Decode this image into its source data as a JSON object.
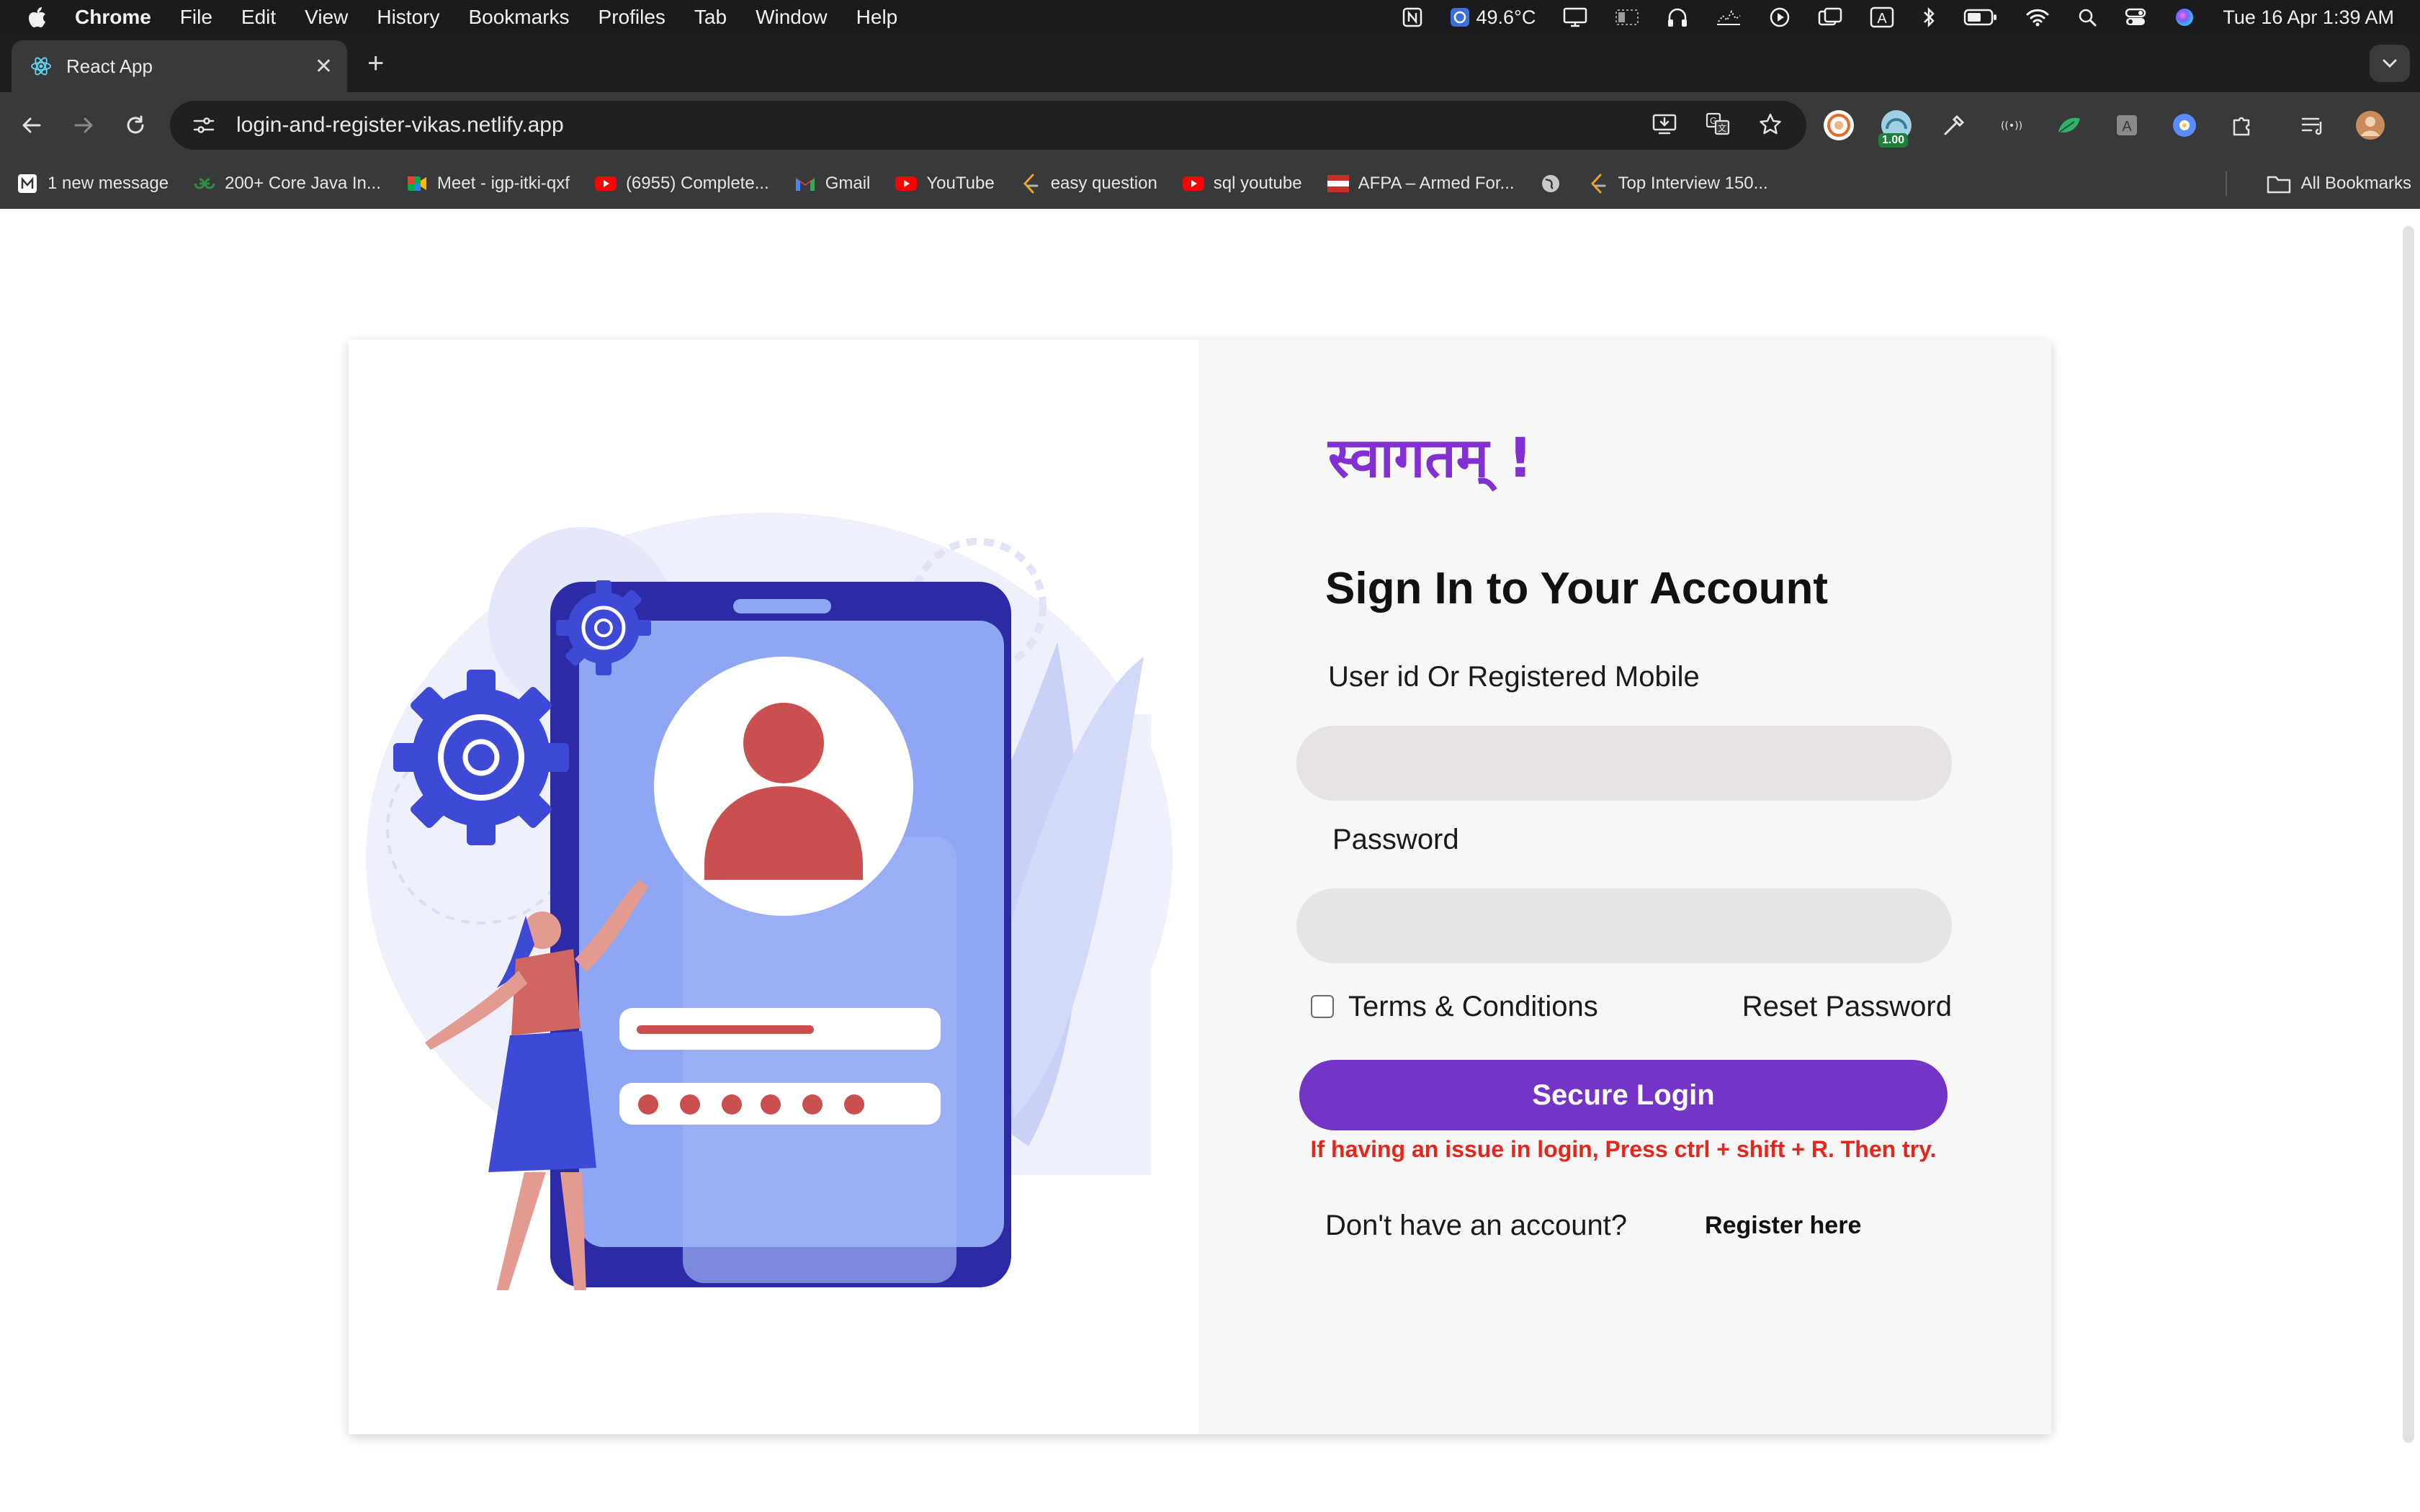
{
  "menubar": {
    "app_name": "Chrome",
    "items": [
      "File",
      "Edit",
      "View",
      "History",
      "Bookmarks",
      "Profiles",
      "Tab",
      "Window",
      "Help"
    ],
    "temperature": "49.6°C",
    "datetime": "Tue 16 Apr  1:39 AM"
  },
  "browser": {
    "tab_title": "React App",
    "url": "login-and-register-vikas.netlify.app",
    "extension_badge": "1.00",
    "bookmarks": [
      "1 new message",
      "200+ Core Java In...",
      "Meet - igp-itki-qxf",
      "(6955) Complete...",
      "Gmail",
      "YouTube",
      "easy question",
      "sql youtube",
      "AFPA – Armed For...",
      "Top Interview 150..."
    ],
    "all_bookmarks": "All Bookmarks"
  },
  "login": {
    "welcome": "स्वागतम् !",
    "title": "Sign In to Your Account",
    "user_label": "User id Or Registered Mobile",
    "user_value": "",
    "password_label": "Password",
    "password_value": "",
    "terms": "Terms & Conditions",
    "reset": "Reset Password",
    "button": "Secure Login",
    "hint": "If having an issue in login, Press ctrl + shift + R. Then try.",
    "no_account": "Don't have an account?",
    "register": "Register here"
  },
  "colors": {
    "brand_purple": "#7434c6",
    "welcome_purple": "#8230d2",
    "error_red": "#e3271d"
  }
}
